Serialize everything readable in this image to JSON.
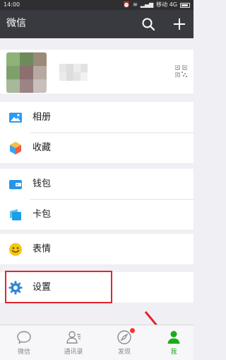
{
  "status_bar": {
    "time": "14:00",
    "carrier": "移动 4G"
  },
  "header": {
    "title": "微信",
    "search_icon": "search-icon",
    "add_icon": "plus-icon"
  },
  "profile": {
    "qr_icon": "qr-code-icon"
  },
  "groups": [
    {
      "items": [
        {
          "label": "相册",
          "icon": "album-icon",
          "color": "#2b9bf4"
        },
        {
          "label": "收藏",
          "icon": "favorites-cube-icon",
          "color": "#f4a83a"
        }
      ]
    },
    {
      "items": [
        {
          "label": "钱包",
          "icon": "wallet-icon",
          "color": "#2796e8"
        },
        {
          "label": "卡包",
          "icon": "card-icon",
          "color": "#1c9fe5"
        }
      ]
    },
    {
      "items": [
        {
          "label": "表情",
          "icon": "emoji-icon",
          "color": "#f5c518"
        }
      ]
    },
    {
      "items": [
        {
          "label": "设置",
          "icon": "gear-icon",
          "color": "#2e86de"
        }
      ]
    }
  ],
  "tabbar": {
    "tabs": [
      {
        "label": "微信",
        "icon": "chat-icon",
        "active": false
      },
      {
        "label": "通讯录",
        "icon": "contacts-icon",
        "active": false
      },
      {
        "label": "发现",
        "icon": "compass-icon",
        "active": false,
        "badge": true
      },
      {
        "label": "我",
        "icon": "me-icon",
        "active": true
      }
    ]
  },
  "colors": {
    "header_bg": "#393a3f",
    "accent_green": "#1aad19",
    "highlight_red": "#e0262d",
    "badge_red": "#f43530"
  }
}
